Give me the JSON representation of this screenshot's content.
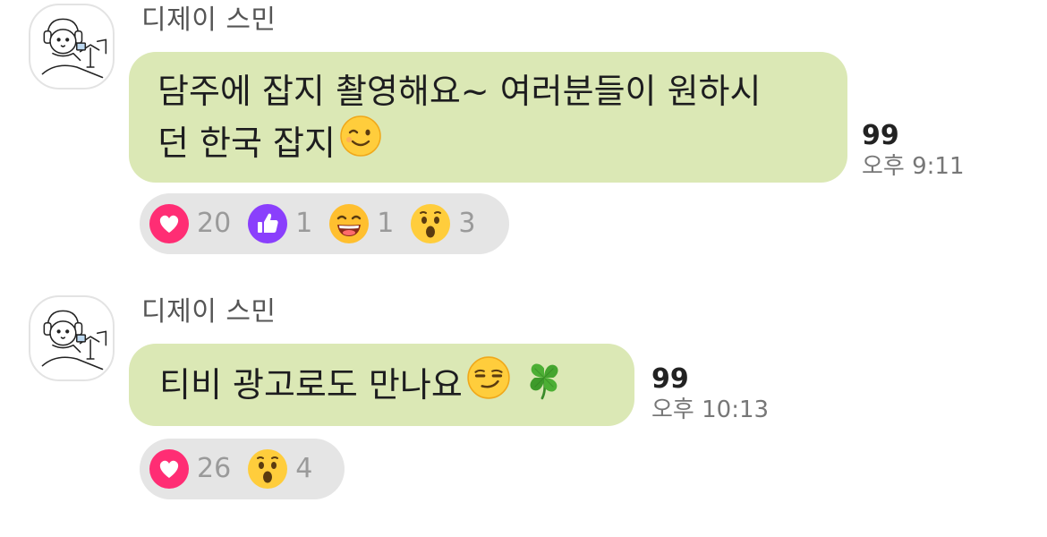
{
  "messages": [
    {
      "sender": "디제이 스민",
      "lines": [
        "담주에 잡지 촬영해요~ 여러분들이 원하시",
        "던 한국 잡지"
      ],
      "trailing_emoji": "winking-face",
      "unread_count": "99",
      "time": "오후 9:11",
      "reactions": [
        {
          "icon": "heart-icon",
          "count": "20"
        },
        {
          "icon": "thumbs-up-icon",
          "count": "1"
        },
        {
          "icon": "grinning-face-icon",
          "count": "1"
        },
        {
          "icon": "surprised-face-icon",
          "count": "3"
        }
      ]
    },
    {
      "sender": "디제이 스민",
      "lines": [
        "티비 광고로도 만나요"
      ],
      "trailing_emoji": "smirking-face four-leaf-clover",
      "unread_count": "99",
      "time": "오후 10:13",
      "reactions": [
        {
          "icon": "heart-icon",
          "count": "26"
        },
        {
          "icon": "surprised-face-icon",
          "count": "4"
        }
      ]
    }
  ],
  "colors": {
    "bubble": "#dbe8b5",
    "reaction_bar": "#e5e5e5",
    "heart": "#ff2d74",
    "thumbs": "#8a3ffc"
  }
}
